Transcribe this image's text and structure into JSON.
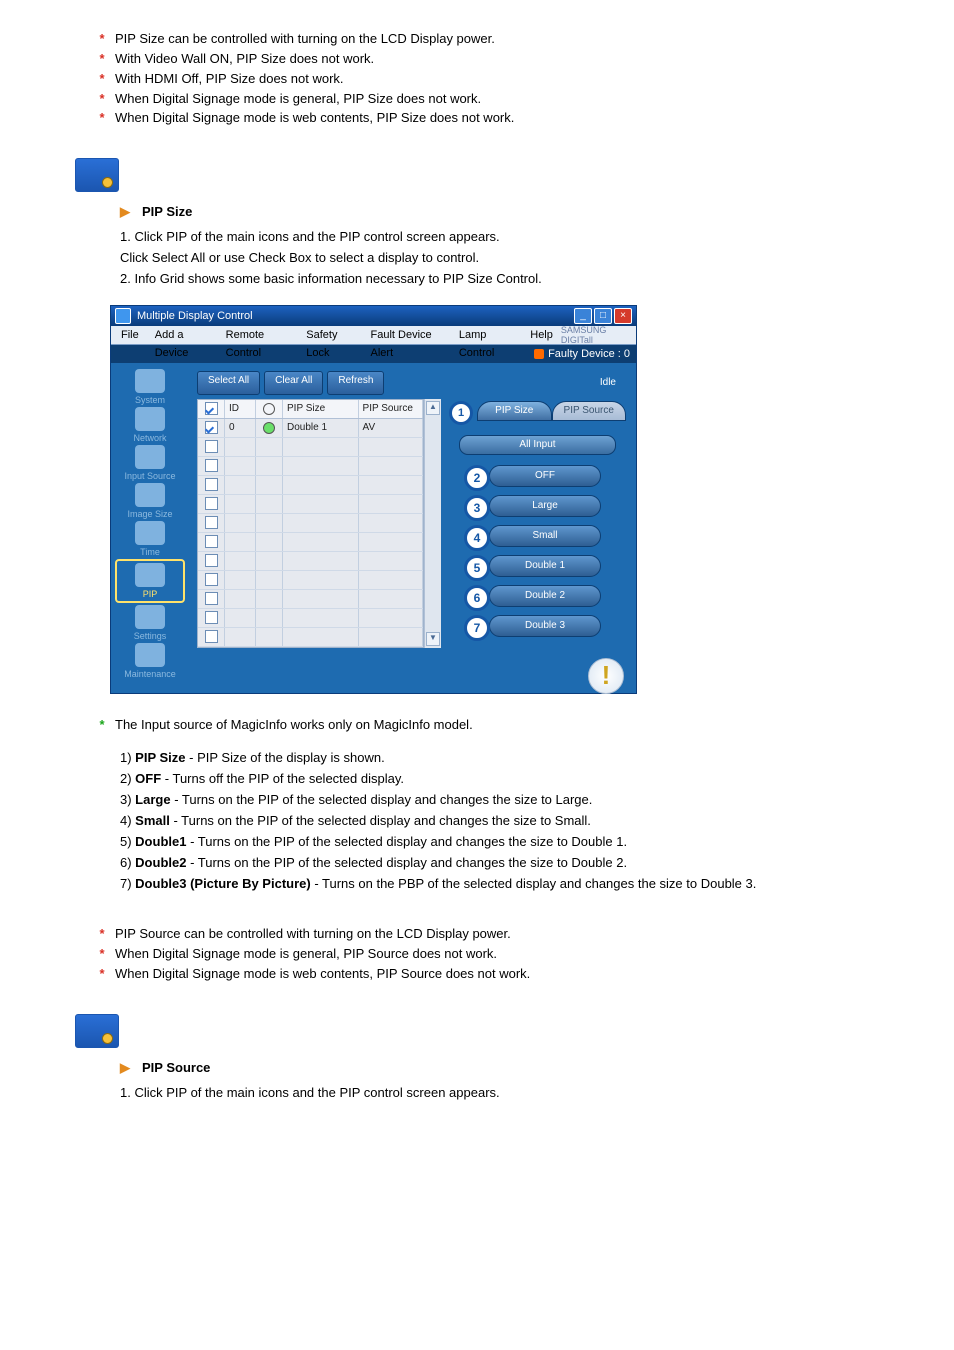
{
  "intro_bullets": [
    "PIP Size can be controlled with turning on the LCD Display power.",
    "With Video Wall ON, PIP Size does not work.",
    "With HDMI Off, PIP Size does not work.",
    "When Digital Signage mode is general, PIP Size does not work.",
    "When Digital Signage mode is web contents, PIP Size does not work."
  ],
  "section1": {
    "lead": "",
    "title": "PIP Size",
    "line1_prefix": "1. ",
    "line1_text": "Click PIP of the main icons and the PIP control screen appears.",
    "line1b": "Click Select All or use Check Box to select a display to control.",
    "line2_prefix": "2. ",
    "line2_text": "Info Grid shows some basic information necessary to PIP Size Control."
  },
  "callouts": [
    {
      "n": "1",
      "bold": "PIP Size",
      "text": " - PIP Size of the display is shown."
    },
    {
      "n": "2",
      "bold": "OFF",
      "text": " - Turns off the PIP of the selected display."
    },
    {
      "n": "3",
      "bold": "Large",
      "text": " - Turns on the PIP of the selected display and changes the size to Large."
    },
    {
      "n": "4",
      "bold": "Small",
      "text": " - Turns on the PIP of the selected display and changes the size to Small."
    },
    {
      "n": "5",
      "bold": "Double1",
      "text": " - Turns on the PIP of the selected display and changes the size to Double 1."
    },
    {
      "n": "6",
      "bold": "Double2",
      "text": " - Turns on the PIP of the selected display and changes the size to Double 2."
    },
    {
      "n": "7",
      "bold": "Double3 (Picture By Picture)",
      "text": " - Turns on the PBP of the selected display and changes the size to Double 3."
    }
  ],
  "post_bullets": [
    "PIP Source can be controlled with turning on the LCD Display power.",
    "When Digital Signage mode is general, PIP Source does not work.",
    "When Digital Signage mode is web contents, PIP Source does not work."
  ],
  "section2": {
    "title": "PIP Source",
    "line1_prefix": "1. ",
    "line1_text": "Click PIP of the main icons and the PIP control screen appears."
  },
  "info_tab": "The Input source of MagicInfo works only on MagicInfo model.",
  "app": {
    "title": "Multiple Display Control",
    "menu": [
      "File",
      "Add a Device",
      "Remote Control",
      "Safety Lock",
      "Fault Device Alert",
      "Lamp Control",
      "Help"
    ],
    "brand": "SAMSUNG DIGITall",
    "faulty": "Faulty Device : 0",
    "toolbar": {
      "select_all": "Select All",
      "clear_all": "Clear All",
      "refresh": "Refresh",
      "idle": "Idle"
    },
    "grid_headers": {
      "id": "ID",
      "pip_size": "PIP Size",
      "pip_source": "PIP Source"
    },
    "grid_row": {
      "id": "0",
      "pip_size": "Double 1",
      "pip_source": "AV"
    },
    "tabs": {
      "pip_size": "PIP Size",
      "pip_source": "PIP Source"
    },
    "all_input": "All Input",
    "pills": [
      "OFF",
      "Large",
      "Small",
      "Double 1",
      "Double 2",
      "Double 3"
    ],
    "sidebar": [
      "System",
      "Network",
      "Input Source",
      "Image Size",
      "Time",
      "PIP",
      "Settings",
      "Maintenance"
    ]
  }
}
